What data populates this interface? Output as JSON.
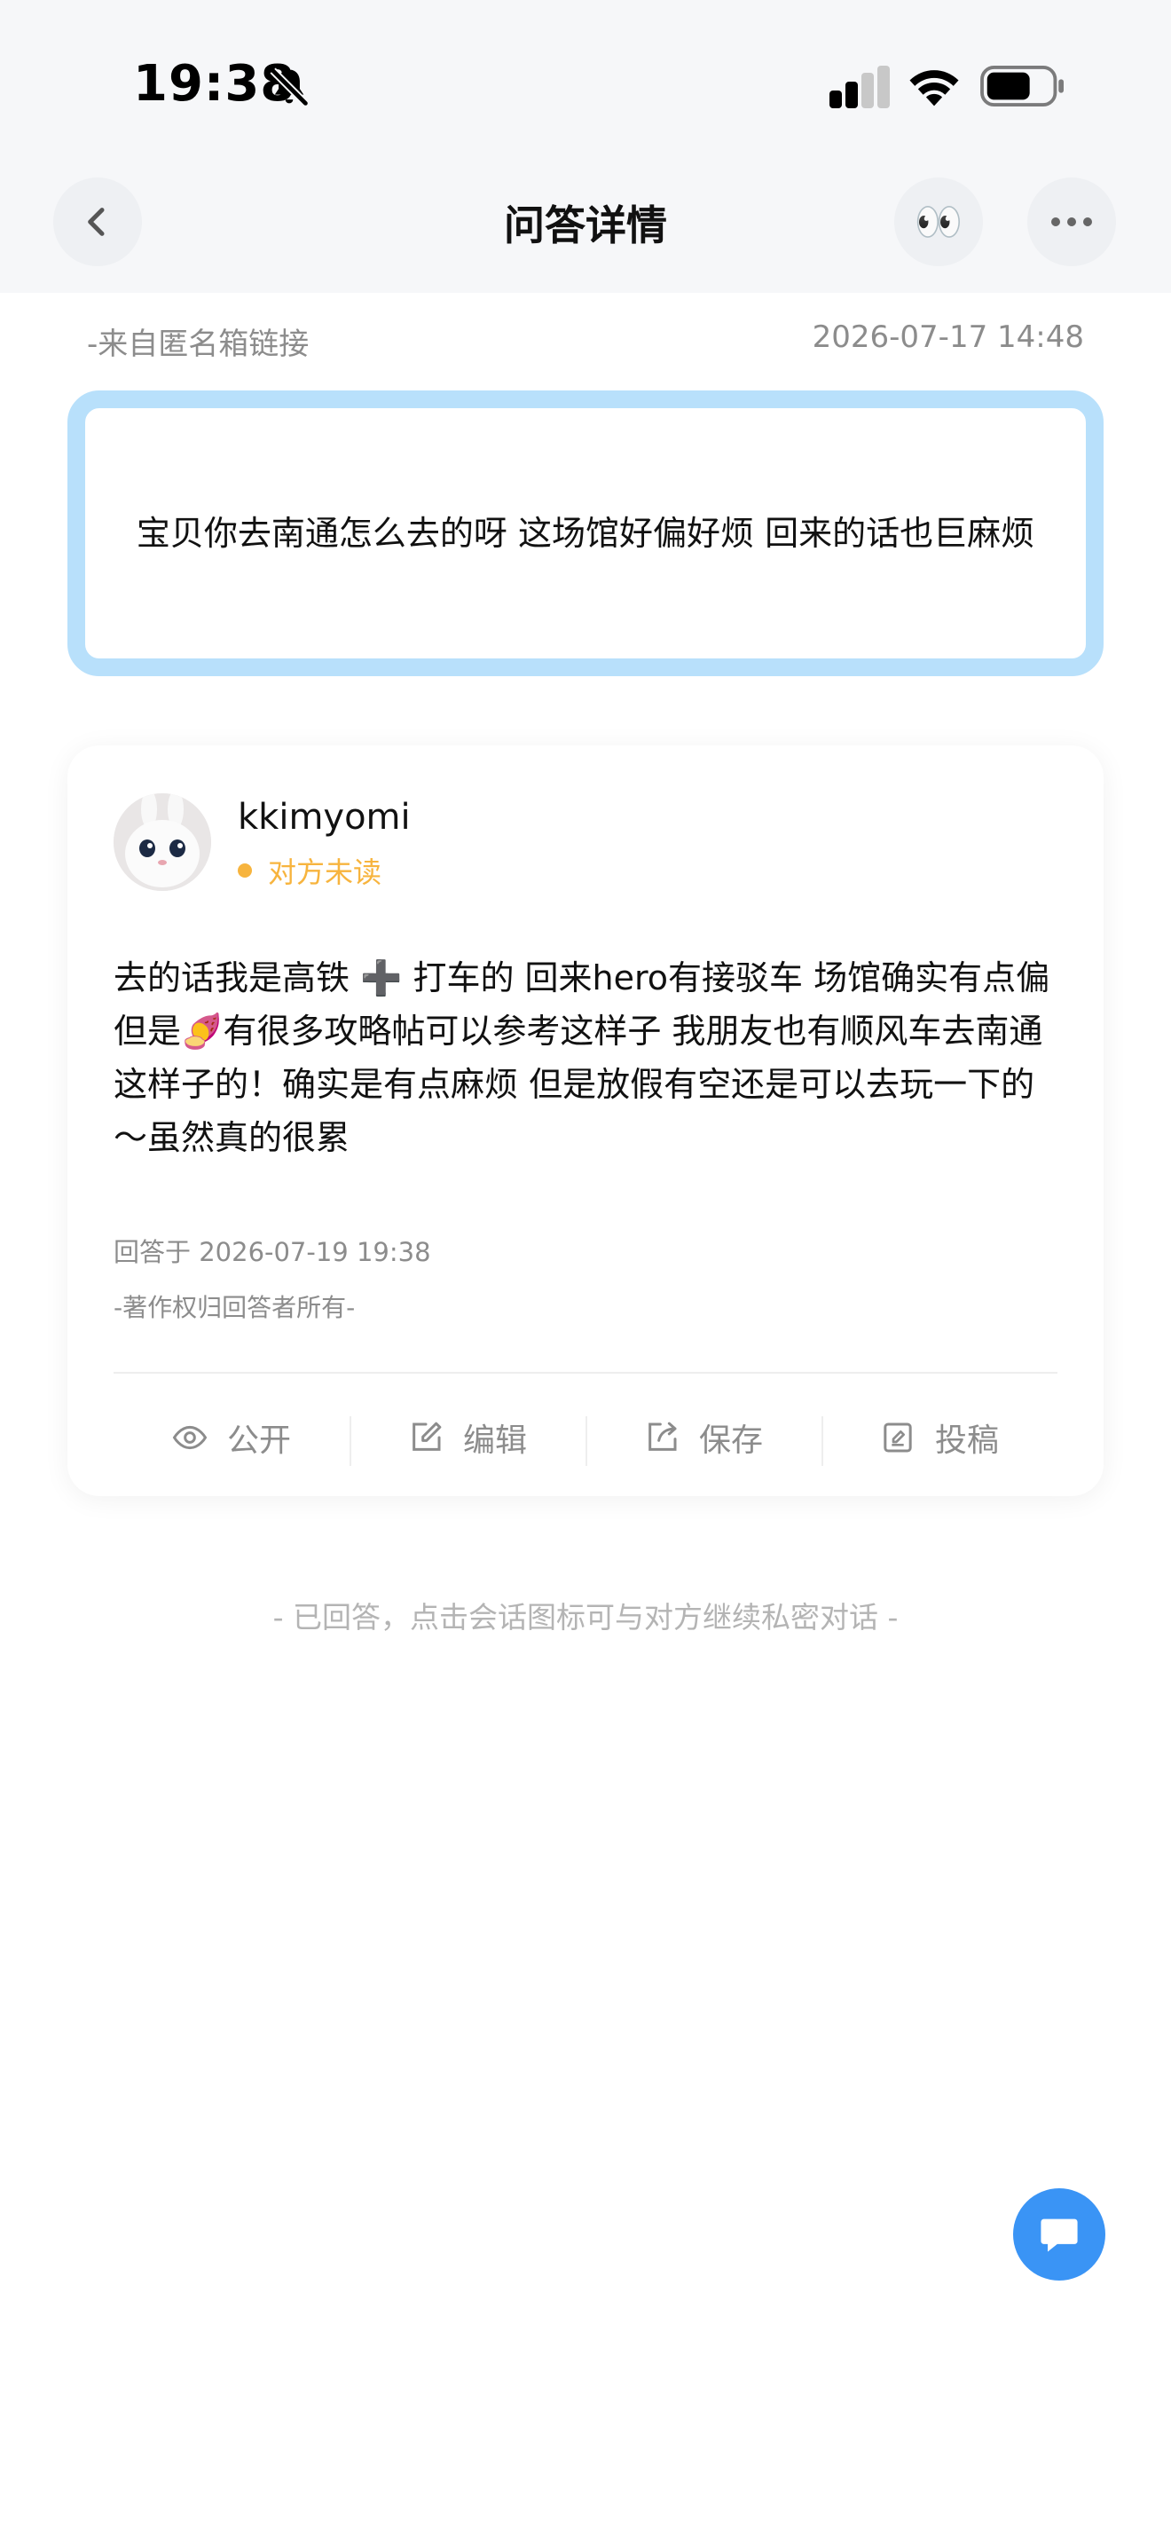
{
  "status_bar": {
    "time": "19:38",
    "icons": [
      "bell-muted-icon",
      "cellular-signal-icon",
      "wifi-icon",
      "battery-icon"
    ]
  },
  "nav": {
    "title": "问答详情",
    "back_icon": "chevron-left-icon",
    "eyes_emoji": "👀",
    "more_icon": "more-dots-icon"
  },
  "question": {
    "source": "-来自匿名箱链接",
    "date": "2026-07-17 14:48",
    "text": "宝贝你去南通怎么去的呀 这场馆好偏好烦 回来的话也巨麻烦"
  },
  "answer": {
    "username": "kkimyomi",
    "read_status": "对方未读",
    "text": "去的话我是高铁 ➕ 打车的 回来hero有接驳车 场馆确实有点偏 但是🍠有很多攻略帖可以参考这样子 我朋友也有顺风车去南通这样子的！确实是有点麻烦 但是放假有空还是可以去玩一下的～虽然真的很累",
    "answered_at": "回答于 2026-07-19 19:38",
    "copyright": "-著作权归回答者所有-",
    "actions": [
      {
        "label": "公开",
        "icon": "eye-icon"
      },
      {
        "label": "编辑",
        "icon": "edit-icon"
      },
      {
        "label": "保存",
        "icon": "share-save-icon"
      },
      {
        "label": "投稿",
        "icon": "submit-icon"
      }
    ]
  },
  "footer_hint": "- 已回答，点击会话图标可与对方继续私密对话 -",
  "colors": {
    "accent_blue": "#3a94f5",
    "question_border": "#b8e0fb",
    "unread_orange": "#f7b43e",
    "secondary_text": "#8c8c8c"
  }
}
